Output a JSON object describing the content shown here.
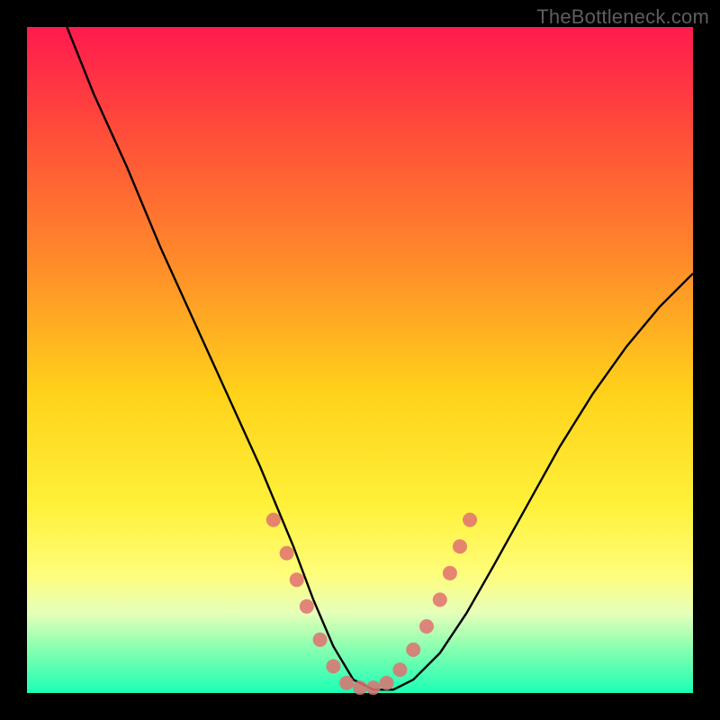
{
  "watermark": "TheBottleneck.com",
  "chart_data": {
    "type": "line",
    "title": "",
    "xlabel": "",
    "ylabel": "",
    "xlim": [
      0,
      100
    ],
    "ylim": [
      0,
      100
    ],
    "grid": false,
    "legend": false,
    "series": [
      {
        "name": "curve",
        "color": "#000000",
        "x": [
          6,
          10,
          15,
          20,
          25,
          30,
          35,
          40,
          43,
          46,
          49,
          52,
          55,
          58,
          62,
          66,
          70,
          75,
          80,
          85,
          90,
          95,
          100
        ],
        "y": [
          100,
          90,
          79,
          67,
          56,
          45,
          34,
          22,
          14,
          7,
          2,
          0.5,
          0.5,
          2,
          6,
          12,
          19,
          28,
          37,
          45,
          52,
          58,
          63
        ]
      },
      {
        "name": "dots",
        "color": "#e07070",
        "type": "scatter",
        "x": [
          37,
          39,
          40.5,
          42,
          44,
          46,
          48,
          50,
          52,
          54,
          56,
          58,
          60,
          62,
          63.5,
          65,
          66.5
        ],
        "y": [
          26,
          21,
          17,
          13,
          8,
          4,
          1.5,
          0.8,
          0.8,
          1.5,
          3.5,
          6.5,
          10,
          14,
          18,
          22,
          26
        ]
      }
    ]
  }
}
